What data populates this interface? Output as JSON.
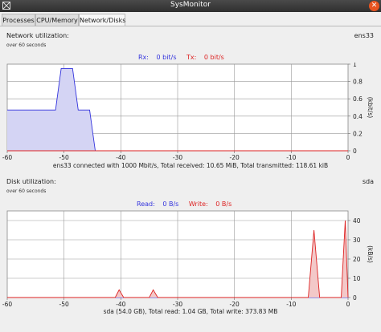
{
  "window": {
    "title": "SysMonitor",
    "close_label": "✕"
  },
  "tabs": [
    {
      "label": "Processes",
      "active": false
    },
    {
      "label": "CPU/Memory",
      "active": false
    },
    {
      "label": "Network/Disks",
      "active": true
    }
  ],
  "network": {
    "heading": "Network utilization:",
    "interface": "ens33",
    "window_note": "over 60 seconds",
    "rx_label": "Rx:",
    "rx_value": "0  bit/s",
    "tx_label": "Tx:",
    "tx_value": "0  bit/s",
    "rx_color": "#3333dd",
    "tx_color": "#dd2222",
    "summary": "ens33 connected with 1000 Mbit/s, Total received: 10.65 MiB, Total transmitted: 118.61 kiB"
  },
  "disk": {
    "heading": "Disk utilization:",
    "device": "sda",
    "window_note": "over 60 seconds",
    "read_label": "Read:",
    "read_value": "0  B/s",
    "write_label": "Write:",
    "write_value": "0  B/s",
    "read_color": "#3333dd",
    "write_color": "#dd2222",
    "summary": "sda (54.0 GB), Total read: 1.04 GB, Total write: 373.83 MB"
  },
  "chart_data": [
    {
      "type": "area",
      "xlim": [
        -60,
        0
      ],
      "ylim": [
        0,
        1
      ],
      "ylabel": "(kbit/s)",
      "x_ticks": [
        "-60",
        "-50",
        "-40",
        "-30",
        "-20",
        "-10",
        "0"
      ],
      "y_ticks": [
        "0",
        "0.2",
        "0.4",
        "0.6",
        "0.8",
        "1"
      ],
      "grid": true,
      "series": [
        {
          "name": "Rx",
          "color": "#3333dd",
          "fill": "#d4d4f4",
          "points": [
            [
              -60,
              0.47
            ],
            [
              -51.5,
              0.47
            ],
            [
              -50.5,
              0.95
            ],
            [
              -48.5,
              0.95
            ],
            [
              -47.5,
              0.47
            ],
            [
              -45.5,
              0.47
            ],
            [
              -44.5,
              0
            ]
          ]
        },
        {
          "name": "Tx",
          "color": "#dd2222",
          "fill": "none",
          "points": [
            [
              -60,
              0
            ],
            [
              0,
              0
            ]
          ]
        }
      ]
    },
    {
      "type": "area",
      "xlim": [
        -60,
        0
      ],
      "ylim": [
        0,
        45
      ],
      "ylabel": "(kB/s)",
      "x_ticks": [
        "-60",
        "-50",
        "-40",
        "-30",
        "-20",
        "-10",
        "0"
      ],
      "y_ticks": [
        "0",
        "10",
        "20",
        "30",
        "40"
      ],
      "grid": true,
      "series": [
        {
          "name": "Read",
          "color": "#3333dd",
          "fill": "none",
          "points": [
            [
              -60,
              0
            ],
            [
              0,
              0
            ]
          ]
        },
        {
          "name": "Write",
          "color": "#dd2222",
          "fill": "#f3c8c8",
          "points": [
            [
              -60,
              0
            ],
            [
              -41,
              0
            ],
            [
              -40.3,
              4
            ],
            [
              -39.5,
              0
            ],
            [
              -35,
              0
            ],
            [
              -34.3,
              4
            ],
            [
              -33.5,
              0
            ],
            [
              -7,
              0
            ],
            [
              -6,
              35
            ],
            [
              -5,
              0
            ],
            [
              -1.2,
              0
            ],
            [
              -0.5,
              40
            ],
            [
              0,
              0
            ]
          ]
        }
      ]
    }
  ]
}
